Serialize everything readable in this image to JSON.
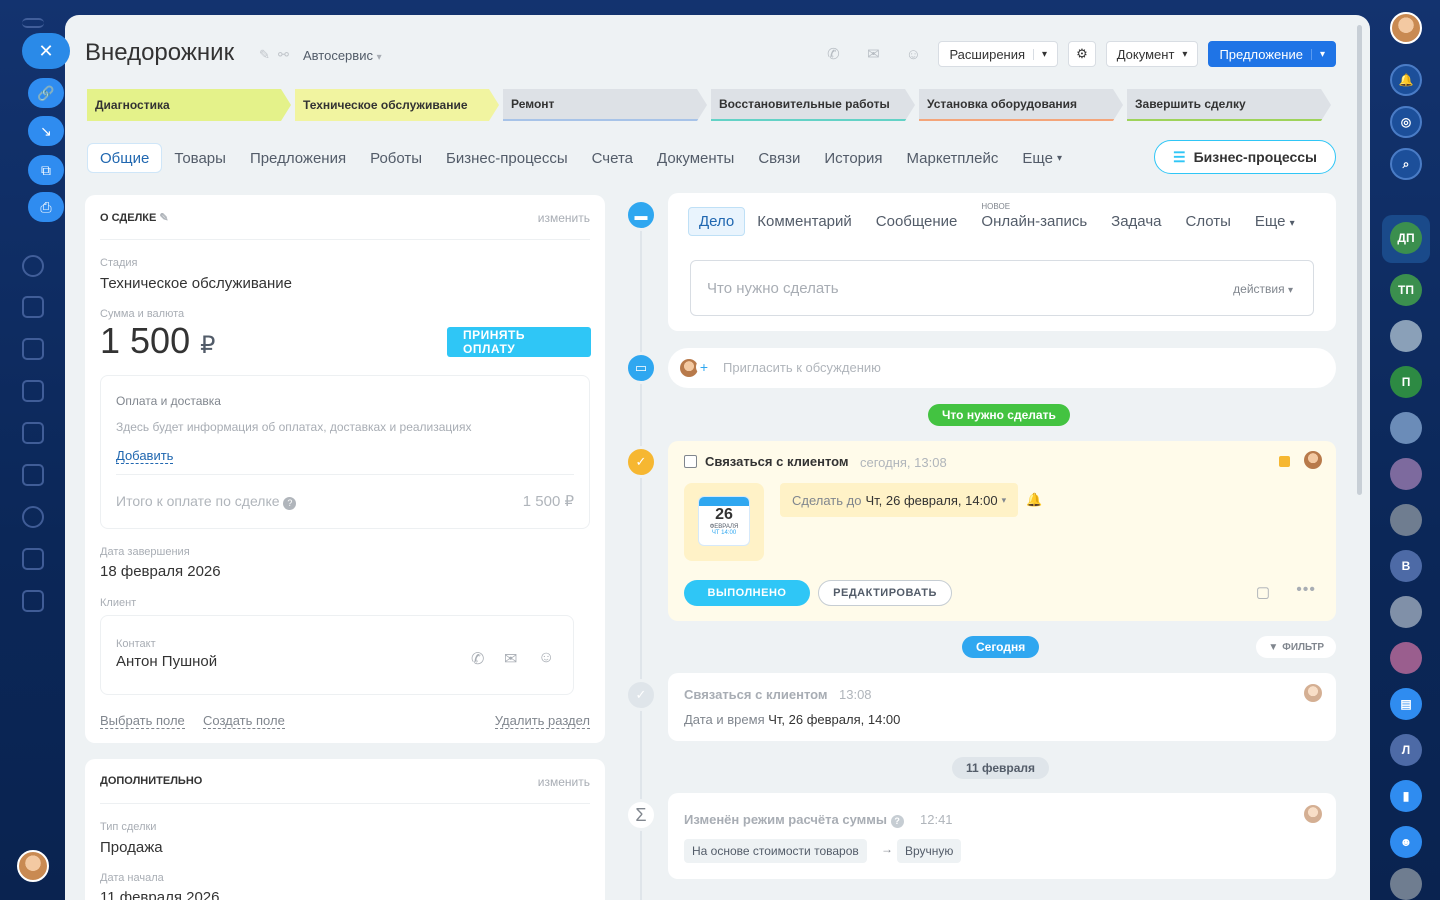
{
  "header": {
    "title": "Внедорожник",
    "category": "Автосервис",
    "extensions_label": "Расширения",
    "document_label": "Документ",
    "proposal_label": "Предложение"
  },
  "stages": [
    {
      "label": "Диагностика",
      "color": "#e4f28a"
    },
    {
      "label": "Техническое обслуживание",
      "color": "#f1f4a0"
    },
    {
      "label": "Ремонт",
      "color": "#dde1e6"
    },
    {
      "label": "Восстановительные работы",
      "color": "#dde1e6"
    },
    {
      "label": "Установка оборудования",
      "color": "#dde1e6"
    },
    {
      "label": "Завершить сделку",
      "color": "#dde1e6"
    }
  ],
  "tabs": [
    "Общие",
    "Товары",
    "Предложения",
    "Роботы",
    "Бизнес-процессы",
    "Счета",
    "Документы",
    "Связи",
    "История",
    "Маркетплейс",
    "Еще"
  ],
  "bp_button": "Бизнес-процессы",
  "about": {
    "heading": "О СДЕЛКЕ",
    "edit": "изменить",
    "stage_label": "Стадия",
    "stage_value": "Техническое обслуживание",
    "sum_label": "Сумма и валюта",
    "sum_value": "1 500",
    "currency": "₽",
    "accept_payment": "ПРИНЯТЬ ОПЛАТУ",
    "payment_title": "Оплата и доставка",
    "payment_info": "Здесь будет информация об оплатах, доставках и реализациях",
    "add_link": "Добавить",
    "total_label": "Итого к оплате по сделке",
    "total_value": "1 500 ₽",
    "close_date_label": "Дата завершения",
    "close_date_value": "18 февраля 2026",
    "client_label": "Клиент",
    "contact_label": "Контакт",
    "contact_name": "Антон Пушной",
    "select_field": "Выбрать поле",
    "create_field": "Создать поле",
    "delete_section": "Удалить раздел"
  },
  "extra": {
    "heading": "ДОПОЛНИТЕЛЬНО",
    "edit": "изменить",
    "type_label": "Тип сделки",
    "type_value": "Продажа",
    "start_label": "Дата начала",
    "start_value": "11 февраля 2026"
  },
  "activity": {
    "tabs": [
      "Дело",
      "Комментарий",
      "Сообщение",
      "Онлайн-запись",
      "Задача",
      "Слоты",
      "Еще"
    ],
    "new_badge": "НОВОЕ",
    "placeholder": "Что нужно сделать",
    "actions": "действия",
    "invite": "Пригласить к обсуждению"
  },
  "todo": {
    "section_badge": "Что нужно сделать",
    "title": "Связаться с клиентом",
    "time": "сегодня, 13:08",
    "cal_day": "26",
    "cal_month": "ФЕВРАЛЯ",
    "cal_time": "ЧТ 14:00",
    "deadline_prefix": "Сделать до",
    "deadline": "Чт, 26 февраля, 14:00",
    "done_btn": "ВЫПОЛНЕНО",
    "edit_btn": "РЕДАКТИРОВАТЬ"
  },
  "history": {
    "today_badge": "Сегодня",
    "filter": "ФИЛЬТР",
    "item1_title": "Связаться с клиентом",
    "item1_time": "13:08",
    "item1_desc_label": "Дата и время",
    "item1_desc_value": "Чт, 26 февраля, 14:00",
    "date_badge": "11 февраля",
    "item2_title": "Изменён режим расчёта суммы",
    "item2_time": "12:41",
    "item2_from": "На основе стоимости товаров",
    "item2_to": "Вручную"
  },
  "right_avatars": [
    "ДП",
    "ТП",
    "П",
    "В",
    "Л"
  ]
}
